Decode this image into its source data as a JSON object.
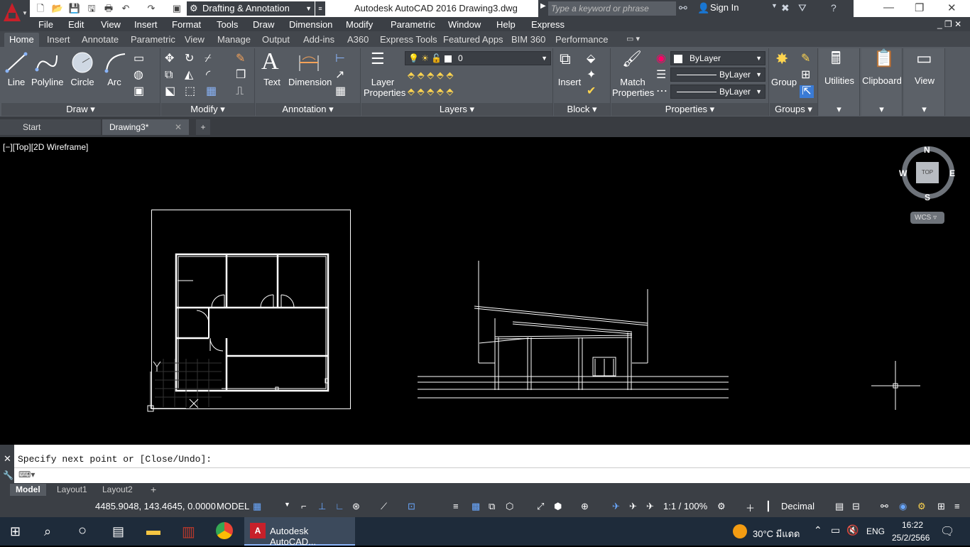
{
  "titlebar": {
    "workspace": "Drafting & Annotation",
    "app_title": "Autodesk AutoCAD 2016    Drawing3.dwg",
    "search_placeholder": "Type a keyword or phrase",
    "sign_in": "Sign In"
  },
  "menubar": [
    "File",
    "Edit",
    "View",
    "Insert",
    "Format",
    "Tools",
    "Draw",
    "Dimension",
    "Modify",
    "Parametric",
    "Window",
    "Help",
    "Express"
  ],
  "ribbon_tabs": [
    "Home",
    "Insert",
    "Annotate",
    "Parametric",
    "View",
    "Manage",
    "Output",
    "Add-ins",
    "A360",
    "Express Tools",
    "Featured Apps",
    "BIM 360",
    "Performance"
  ],
  "ribbon": {
    "draw": {
      "label": "Draw",
      "line": "Line",
      "polyline": "Polyline",
      "circle": "Circle",
      "arc": "Arc"
    },
    "modify": {
      "label": "Modify"
    },
    "annotation": {
      "label": "Annotation",
      "text": "Text",
      "dimension": "Dimension"
    },
    "layers": {
      "label": "Layers",
      "layer_properties": "Layer Properties",
      "current_layer": "0"
    },
    "block": {
      "label": "Block",
      "insert": "Insert"
    },
    "properties": {
      "label": "Properties",
      "match": "Match Properties",
      "color": "ByLayer",
      "linetype": "ByLayer",
      "lineweight": "ByLayer"
    },
    "groups": {
      "label": "Groups",
      "group": "Group"
    },
    "utilities": {
      "label": "Utilities"
    },
    "clipboard": {
      "label": "Clipboard"
    },
    "view": {
      "label": "View"
    }
  },
  "file_tabs": {
    "start": "Start",
    "drawing": "Drawing3*"
  },
  "viewport_label": "[−][Top][2D Wireframe]",
  "viewcube": {
    "n": "N",
    "s": "S",
    "e": "E",
    "w": "W",
    "top": "TOP",
    "wcs": "WCS"
  },
  "command": {
    "history": "Specify next point or [Close/Undo]:"
  },
  "layout_tabs": [
    "Model",
    "Layout1",
    "Layout2"
  ],
  "status": {
    "coords": "4485.9048, 143.4645, 0.0000",
    "model": "MODEL",
    "scale": "1:1 / 100%",
    "units": "Decimal"
  },
  "taskbar": {
    "app": "Autodesk AutoCAD...",
    "weather": "30°C มีแดด",
    "lang": "ENG",
    "time": "16:22",
    "date": "25/2/2566"
  }
}
